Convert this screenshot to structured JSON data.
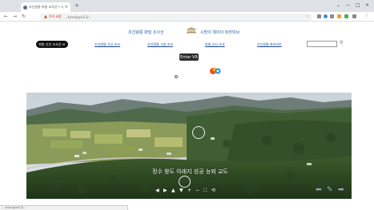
{
  "browser": {
    "tab_title": "조선왕릉 파빌 조사산 / 시...",
    "new_tab_symbol": "+",
    "tab_close_symbol": "×",
    "security_label": "주의 요함",
    "url": "...kr/vr/pyo3-2/...",
    "window_controls": [
      "⌄",
      "−",
      "□",
      "×"
    ],
    "nav_icons": [
      "back-icon",
      "forward-icon",
      "reload-icon"
    ],
    "extension_colors": [
      "#888888",
      "#3c8dde",
      "#8b8b8b",
      "#e8a33d",
      "#4caf50",
      "#888888"
    ]
  },
  "header": {
    "title_left": "조선왕릉 파빌 조사산",
    "title_right": "시방의 제야의 파라미브",
    "menu": [
      {
        "label": "파빌 산신 조사산 vr"
      },
      {
        "label": "조선왕릉 산신 조사"
      },
      {
        "label": "조선왕릉 시방 조사"
      },
      {
        "label": "파빌 산신 조사"
      },
      {
        "label": "조선왕릉 파라미브"
      }
    ],
    "search_placeholder": ""
  },
  "vr": {
    "enter_vr_label": "Enter VR"
  },
  "panorama": {
    "caption": "정수 왕도 아래지 성공 능뫼 교도",
    "controls": [
      "◀",
      "▶",
      "▲",
      "▼",
      "+",
      "−",
      "⛶",
      "⟲"
    ],
    "nav_prev": "⬅",
    "nav_edit": "✎",
    "nav_next": "➡"
  },
  "status_bar": {
    "text": "... kr/vr/pyo3-2/... "
  },
  "colors": {
    "title_blue": "#1f5fa8",
    "menu_active_bg": "#111111",
    "vr_button_bg": "#2b2b2b"
  }
}
